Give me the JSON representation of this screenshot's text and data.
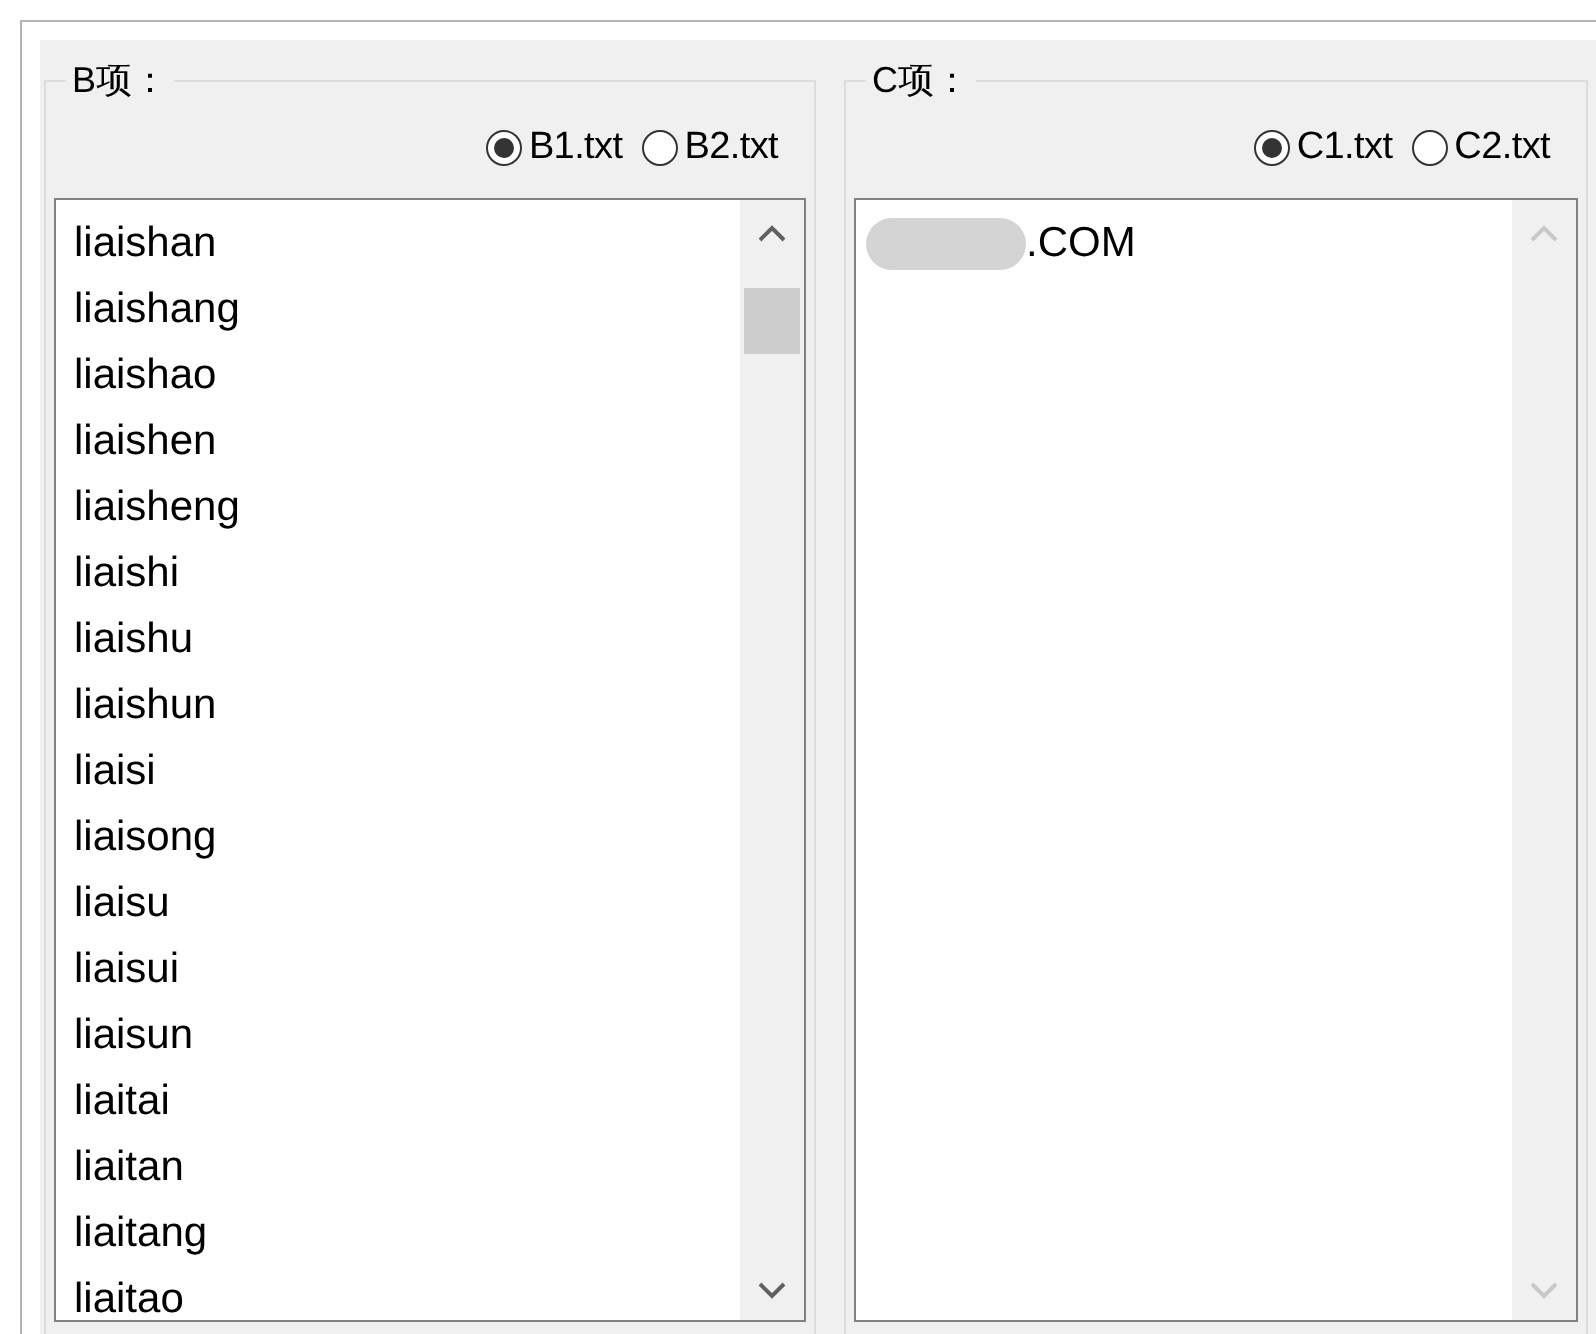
{
  "groups": [
    {
      "title": "B项：",
      "options": [
        {
          "label": "B1.txt",
          "selected": true
        },
        {
          "label": "B2.txt",
          "selected": false
        }
      ],
      "items": [
        "liaishan",
        "liaishang",
        "liaishao",
        "liaishen",
        "liaisheng",
        "liaishi",
        "liaishu",
        "liaishun",
        "liaisi",
        "liaisong",
        "liaisu",
        "liaisui",
        "liaisun",
        "liaitai",
        "liaitan",
        "liaitang",
        "liaitao"
      ],
      "scrollable": true
    },
    {
      "title": "C项：",
      "options": [
        {
          "label": "C1.txt",
          "selected": true
        },
        {
          "label": "C2.txt",
          "selected": false
        }
      ],
      "items": [
        {
          "kind": "redacted",
          "text": ".COM"
        }
      ],
      "scrollable": false
    }
  ]
}
